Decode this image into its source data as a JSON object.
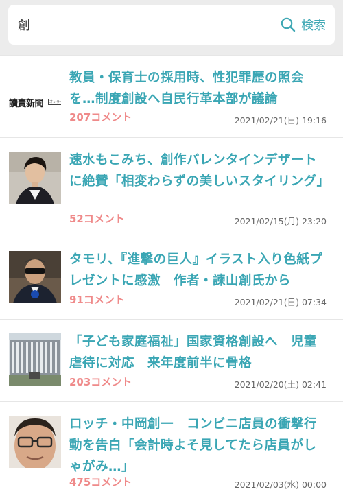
{
  "search": {
    "value": "創",
    "button_label": "検索"
  },
  "articles": [
    {
      "title": "教員・保育士の採用時、性犯罪歴の照会を…制度創設へ自民行革本部が議論",
      "comments": "207コメント",
      "date": "2021/02/21(日) 19:16",
      "thumbnail": "yomiuri-logo",
      "thumbnail_text": "讀賣新聞",
      "thumbnail_subtext": "オンライン"
    },
    {
      "title": "速水もこみち、創作バレンタインデザートに絶賛「相変わらずの美しいスタイリング」",
      "comments": "52コメント",
      "date": "2021/02/15(月) 23:20",
      "thumbnail": "man-portrait-photo"
    },
    {
      "title": "タモリ、『進撃の巨人』イラスト入り色紙プレゼントに感激　作者・諫山創氏から",
      "comments": "91コメント",
      "date": "2021/02/21(日) 07:34",
      "thumbnail": "man-sunglasses-photo"
    },
    {
      "title": "「子ども家庭福祉」国家資格創設へ　児童虐待に対応　来年度前半に骨格",
      "comments": "203コメント",
      "date": "2021/02/20(土) 02:41",
      "thumbnail": "government-building-photo"
    },
    {
      "title": "ロッチ・中岡創一　コンビニ店員の衝撃行動を告白「会計時よそ見してたら店員がしゃがみ…」",
      "comments": "475コメント",
      "date": "2021/02/03(水) 00:00",
      "thumbnail": "man-glasses-photo"
    }
  ],
  "colors": {
    "accent": "#3aa6b4",
    "comments": "#ef8a8a",
    "header_bg": "#ececec"
  }
}
